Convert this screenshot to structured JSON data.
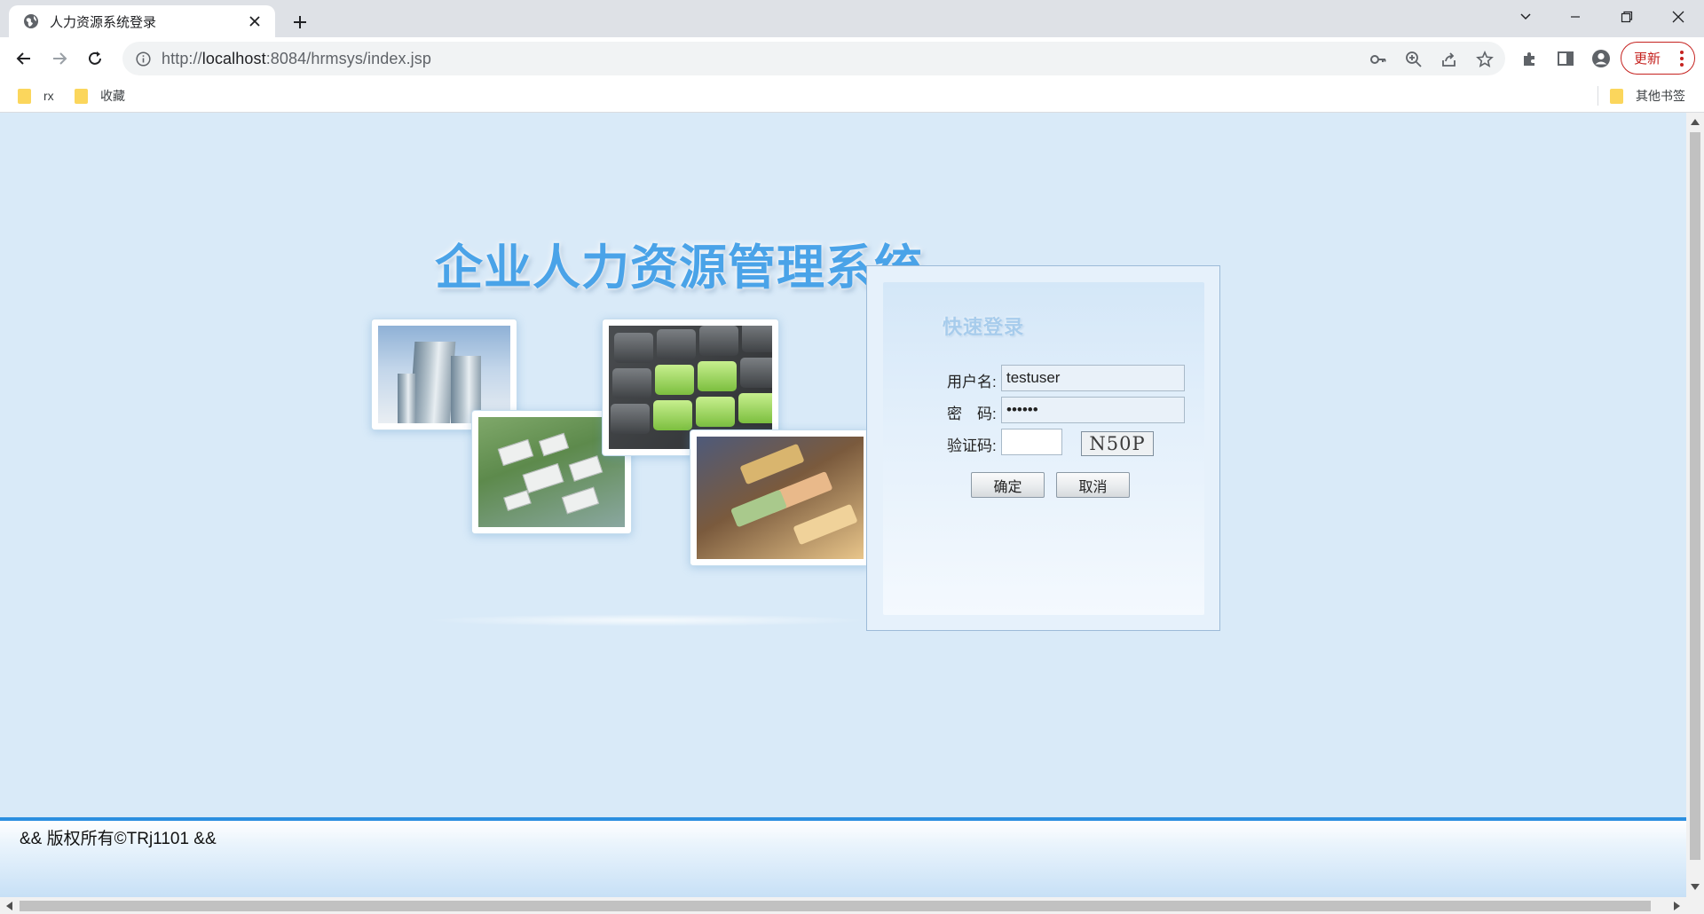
{
  "browser": {
    "tab_title": "人力资源系统登录",
    "tab_close_icon": "close-icon",
    "new_tab_icon": "plus-icon",
    "url_scheme": "http://",
    "url_host": "localhost",
    "url_rest": ":8084/hrmsys/index.jsp",
    "update_label": "更新",
    "bookmarks": [
      {
        "label": "rx",
        "icon": "folder-icon"
      },
      {
        "label": "收藏",
        "icon": "folder-icon"
      }
    ],
    "other_bookmarks_label": "其他书签"
  },
  "page": {
    "system_title": "企业人力资源管理系统",
    "login": {
      "heading": "快速登录",
      "username_label": "用户名:",
      "username_value": "testuser",
      "password_label": "密　码:",
      "password_value": "••••••",
      "captcha_label": "验证码:",
      "captcha_value": "",
      "captcha_image_text": "N50P",
      "confirm_label": "确定",
      "cancel_label": "取消"
    },
    "footer_text": "&& 版权所有©TRj1101 &&"
  },
  "colors": {
    "page_background": "#d9eaf8",
    "title_blue": "#4aa3e8",
    "footer_accent": "#2b8fe0",
    "update_red": "#c5221f"
  }
}
